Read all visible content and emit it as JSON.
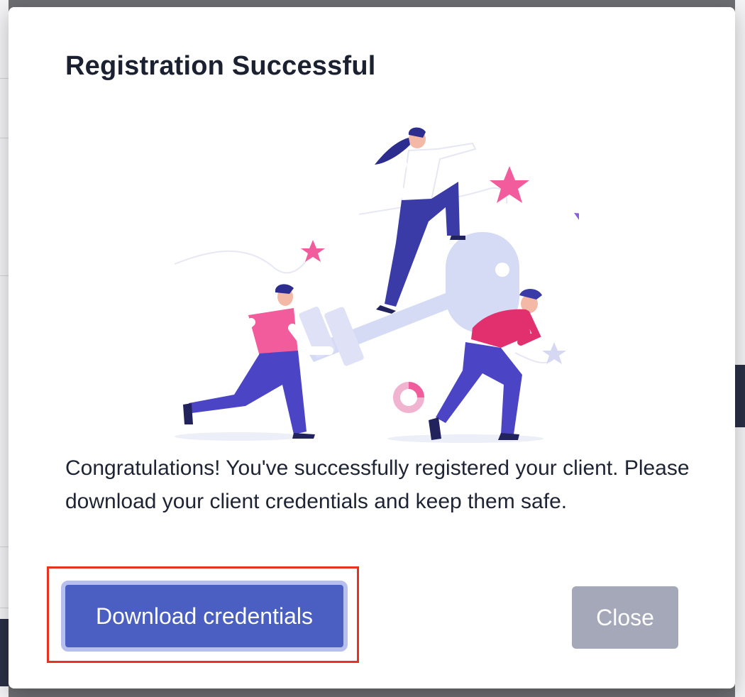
{
  "modal": {
    "title": "Registration Successful",
    "message": "Congratulations! You've successfully registered your client. Please download your client credentials and keep them safe.",
    "download_label": "Download credentials",
    "close_label": "Close"
  },
  "illustration": {
    "name": "team-carrying-key-illustration"
  },
  "colors": {
    "primary": "#4a5fc1",
    "primary_focus_ring": "#b7c0ec",
    "close_bg": "#a4a8b8",
    "highlight_border": "#e8321f",
    "title_text": "#1b2130",
    "overlay": "#6d6e72"
  }
}
